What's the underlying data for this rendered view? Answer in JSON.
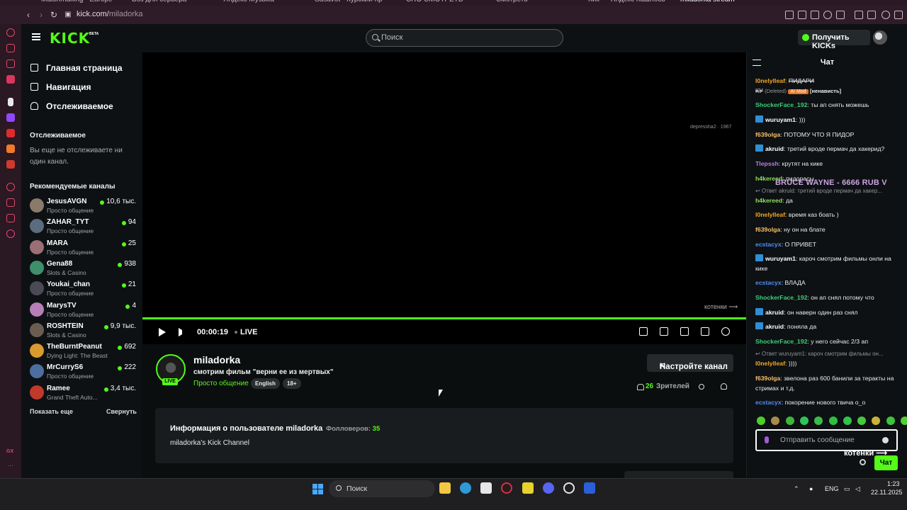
{
  "browser": {
    "tabs": [
      "Matchmaking - Europe",
      "Боз для сервера",
      "Яндекс Музыка",
      "Sasavot - Курский пр",
      "CRO CMOTPETЬ",
      "Смотреть",
      "Кик — Яндекс нашлось",
      "miladorka stream"
    ],
    "url_domain": "kick.com/",
    "url_path": "miladorka"
  },
  "header": {
    "logo": "KICK",
    "logo_badge": "BETA",
    "search_placeholder": "Поиск",
    "get_kicks_label": "Получить KICKs"
  },
  "sidebar": {
    "nav": [
      "Главная страница",
      "Навигация",
      "Отслеживаемое"
    ],
    "following_heading": "Отслеживаемое",
    "no_following_text": "Вы еще не отслеживаете ни один канал.",
    "recommended_heading": "Рекомендуемые каналы",
    "channels": [
      {
        "name": "JesusAVGN",
        "category": "Просто общение",
        "viewers": "10,6 тыс.",
        "color": "#8a7a6a"
      },
      {
        "name": "ZAHAR_TYT",
        "category": "Просто общение",
        "viewers": "94",
        "color": "#5a6c7e"
      },
      {
        "name": "MARA",
        "category": "Просто общение",
        "viewers": "25",
        "color": "#9b6f74"
      },
      {
        "name": "Gena88",
        "category": "Slots & Casino",
        "viewers": "938",
        "color": "#3f8f6c"
      },
      {
        "name": "Youkai_chan",
        "category": "Просто общение",
        "viewers": "21",
        "color": "#4a4a55"
      },
      {
        "name": "MarysTV",
        "category": "Просто общение",
        "viewers": "4",
        "color": "#b67fb8"
      },
      {
        "name": "ROSHTEIN",
        "category": "Slots & Casino",
        "viewers": "9,9 тыс.",
        "color": "#6b5c52"
      },
      {
        "name": "TheBurntPeanut",
        "category": "Dying Light: The Beast",
        "viewers": "692",
        "color": "#d99a2e"
      },
      {
        "name": "MrCurryS6",
        "category": "Просто общение",
        "viewers": "222",
        "color": "#4d6fa0"
      },
      {
        "name": "Ramee",
        "category": "Grand Theft Auto...",
        "viewers": "3,4 тыс.",
        "color": "#c0392b"
      }
    ],
    "show_more": "Показать еще",
    "collapse": "Свернуть"
  },
  "player": {
    "watermark": "depressha2 · 1967",
    "overlay_text": "котенки ⟶",
    "time": "00:00:19",
    "live": "LIVE"
  },
  "channel": {
    "live_badge": "LIVE",
    "name": "miladorka",
    "title": "смотрим фильм \"верни ее из мертвых\"",
    "category": "Просто общение",
    "tags": [
      "English",
      "18+"
    ],
    "setup_button": "Настройте канал",
    "viewers": "26",
    "viewers_label": "Зрителей"
  },
  "about": {
    "title": "Информация о пользователе miladorka",
    "followers_label": "Фолловеров:",
    "followers": "35",
    "description": "miladorka's Kick Channel"
  },
  "chat": {
    "title": "Чат",
    "donation": "BRUCE WAYNE - 6666 RUB      V",
    "messages": [
      {
        "user": "l0nelylleaf",
        "color": "#f5a623",
        "text": "ПИДАРИ"
      },
      {
        "user": "ShockerFace_192",
        "color": "#3ad17a",
        "text": "ты ап снять можешь"
      },
      {
        "user": "wuruyam1",
        "color": "#ffffff",
        "text": ")))"
      },
      {
        "user": "f639olga",
        "color": "#f5c06b",
        "text": "ПОТОМУ ЧТО Я ПИДОР"
      },
      {
        "user": "akruid",
        "color": "#ffffff",
        "text": "третий вроде пермач да хакерид?"
      },
      {
        "user": "Tlepssh",
        "color": "#b77cf0",
        "text": "крутят на кике"
      },
      {
        "user": "h4kereed",
        "color": "#8de05a",
        "text": "пидорасы"
      },
      {
        "user": "h4kereed",
        "color": "#8de05a",
        "text": "да"
      },
      {
        "user": "l0nelylleaf",
        "color": "#f5a623",
        "text": "время каз боать )"
      },
      {
        "user": "f639olga",
        "color": "#f5c06b",
        "text": "ну он на блате"
      },
      {
        "user": "ecstacyx",
        "color": "#4f8df5",
        "text": "О ПРИВЕТ"
      },
      {
        "user": "wuruyam1",
        "color": "#ffffff",
        "text": "кароч смотрим фильмы онли на кике"
      },
      {
        "user": "ecstacyx",
        "color": "#4f8df5",
        "text": "ВЛАДА"
      },
      {
        "user": "ShockerFace_192",
        "color": "#3ad17a",
        "text": "он ап снял потому что"
      },
      {
        "user": "akruid",
        "color": "#ffffff",
        "text": "он наверн один раз снял"
      },
      {
        "user": "akruid",
        "color": "#ffffff",
        "text": "поняла да"
      },
      {
        "user": "ShockerFace_192",
        "color": "#3ad17a",
        "text": "у него сейчас 2/3 ап"
      },
      {
        "user": "l0nelylleaf",
        "color": "#f5a623",
        "text": "))))"
      },
      {
        "user": "f639olga",
        "color": "#f5c06b",
        "text": "звелона раз 600 банили за теракты на стримах и т.д."
      },
      {
        "user": "ecstacyx",
        "color": "#4f8df5",
        "text": "покорение нового твича о_о"
      }
    ],
    "deleted_line": {
      "prefix": "КУ",
      "deleted": "(Deleted)",
      "mod": "AI Mod",
      "reason": "[ненависть]"
    },
    "replies": [
      "↩ Ответ akruid: третий вроде пермач да хакер...",
      "↩ Ответ wuruyam1: кароч смотрим фильмы он..."
    ],
    "input_placeholder": "Отправить сообщение",
    "overlay_text": "котенки ⟶",
    "send_button": "Чат"
  },
  "taskbar": {
    "search_label": "Поиск",
    "lang": "ENG",
    "time": "1:23",
    "date": "22.11.2025"
  },
  "colors": {
    "accent": "#53fc18",
    "background": "#0b0e0f",
    "panel": "#191c1e"
  }
}
